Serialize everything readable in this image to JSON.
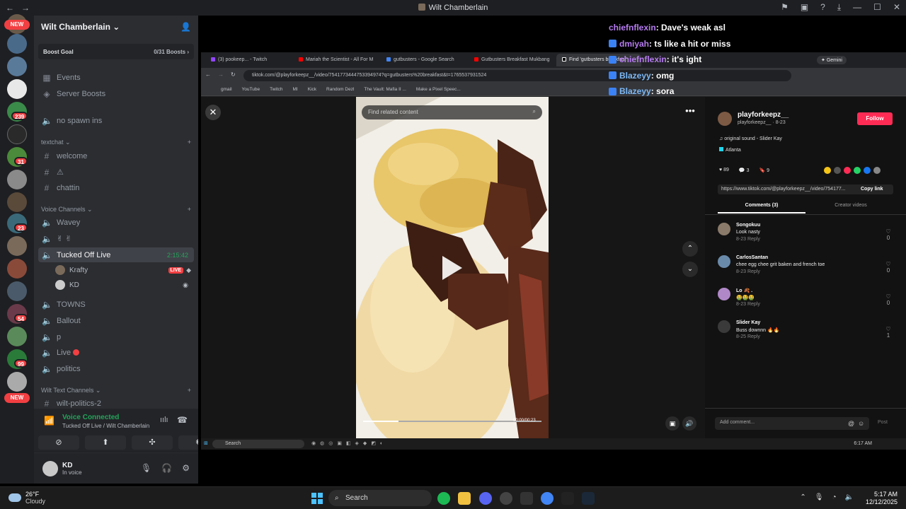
{
  "window": {
    "title": "Wilt Chamberlain"
  },
  "rail": {
    "new_label_top": "NEW",
    "new_label_bottom": "NEW",
    "badges": [
      "239",
      "31",
      "23",
      "54",
      "99"
    ]
  },
  "guild": {
    "name": "Wilt Chamberlain",
    "boost_goal_label": "Boost Goal",
    "boost_count": "0/31 Boosts",
    "events": "Events",
    "server_boosts": "Server Boosts",
    "no_spawn": "no spawn ins",
    "textchat_category": "textchat",
    "channels_text": [
      "welcome",
      "⚠",
      "chattin"
    ],
    "voice_category": "Voice Channels",
    "voice_channels": [
      "Wavey",
      "✌ ✌",
      "Tucked Off Live"
    ],
    "active_timer": "2:15:42",
    "voice_users": [
      {
        "name": "Krafty",
        "live": "LIVE"
      },
      {
        "name": "KD"
      }
    ],
    "voice_channels_more": [
      "TOWNS",
      "Ballout",
      "p",
      "Live",
      "politics"
    ],
    "wilt_text_category": "Wilt Text Channels",
    "wilt_politics": "wilt-politics-2"
  },
  "voice_panel": {
    "status": "Voice Connected",
    "sub": "Tucked Off Live / Wilt Chamberlain"
  },
  "user_panel": {
    "name": "KD",
    "status": "In voice"
  },
  "chat_overlay": [
    {
      "user": "chiefnflexin",
      "msg": ": Dave's weak asl",
      "color": "purple",
      "icon": false
    },
    {
      "user": "dmiyah",
      "msg": ": ts like a hit or miss",
      "color": "purple",
      "icon": true
    },
    {
      "user": "chiefnflexin",
      "msg": ": it's ight",
      "color": "purple",
      "icon": true
    },
    {
      "user": "Blazeyy",
      "msg": ": omg",
      "color": "blue",
      "icon": true
    },
    {
      "user": "Blazeyy",
      "msg": ": sora",
      "color": "blue",
      "icon": true
    }
  ],
  "browser": {
    "tabs": [
      "(3) pookeep... - Twitch",
      "Mariah the Scientist - All For M",
      "gutbusters - Google Search",
      "Gutbusters Breakfast Mukbang",
      "Find 'gutbusters breakfast'"
    ],
    "gemini": "Gemini",
    "url": "tiktok.com/@playforkeepz__/video/7541773444753394974?q=gutbusters%20breakfast&t=1765537931524",
    "bookmarks": [
      "gmail",
      "YouTube",
      "Twitch",
      "MI",
      "Kick",
      "Random Dezl",
      "The Vault: Mafia II ...",
      "Make a Pixel Speec..."
    ]
  },
  "tiktok": {
    "search_placeholder": "Find related content",
    "author": "playforkeepz__",
    "handle": "playforkeepz__ · 8-23",
    "follow": "Follow",
    "sound": "original sound - Slider Kay",
    "location": "Atlanta",
    "likes": "89",
    "comments_count": "3",
    "saves": "9",
    "link": "https://www.tiktok.com/@playforkeepz__/video/754177...",
    "copy_link": "Copy link",
    "tab_comments": "Comments (3)",
    "tab_creator": "Creator videos",
    "video_time": "00:00/00:23",
    "comments": [
      {
        "name": "Songokuu",
        "text": "Look nasty",
        "meta": "8-23    Reply",
        "likes": "0"
      },
      {
        "name": "CarlosSantan",
        "text": "chee egg chee grit baken and french toe",
        "meta": "8-23    Reply",
        "likes": "0"
      },
      {
        "name": "Lo 🍂 .",
        "text": "🤮🤮🤮",
        "meta": "8-23    Reply",
        "likes": "0"
      },
      {
        "name": "Slider Kay",
        "text": "Buss downnn 🔥🔥",
        "meta": "8-25    Reply",
        "likes": "1"
      }
    ],
    "add_comment": "Add comment...",
    "post": "Post"
  },
  "inner_taskbar": {
    "search": "Search",
    "time": "6:17 AM"
  },
  "taskbar": {
    "temp": "26°F",
    "weather": "Cloudy",
    "search": "Search",
    "time": "5:17 AM",
    "date": "12/12/2025"
  },
  "colors": {
    "accent_green": "#23a55a",
    "live_red": "#f23f42",
    "tiktok_red": "#fe2c55"
  }
}
